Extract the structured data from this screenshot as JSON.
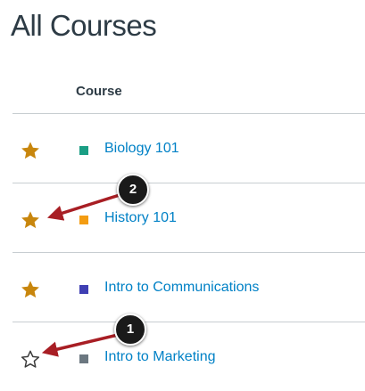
{
  "page": {
    "title": "All Courses"
  },
  "table": {
    "column_header": "Course"
  },
  "courses": [
    {
      "name": "Biology 101",
      "favorited": true,
      "color": "#1a9e84"
    },
    {
      "name": "History 101",
      "favorited": true,
      "color": "#f39c12"
    },
    {
      "name": "Intro to Communications",
      "favorited": true,
      "color": "#3f3fb3"
    },
    {
      "name": "Intro to Marketing",
      "favorited": false,
      "color": "#6b7780"
    }
  ],
  "callouts": [
    {
      "label": "2"
    },
    {
      "label": "1"
    }
  ],
  "colors": {
    "star_filled": "#c8860d",
    "star_outline": "#3a3a3a",
    "link": "#0081c6",
    "arrow": "#a81e24",
    "badge": "#1a1a1a"
  },
  "icons": {
    "favorite": "star-filled-icon",
    "not_favorite": "star-outline-icon"
  }
}
